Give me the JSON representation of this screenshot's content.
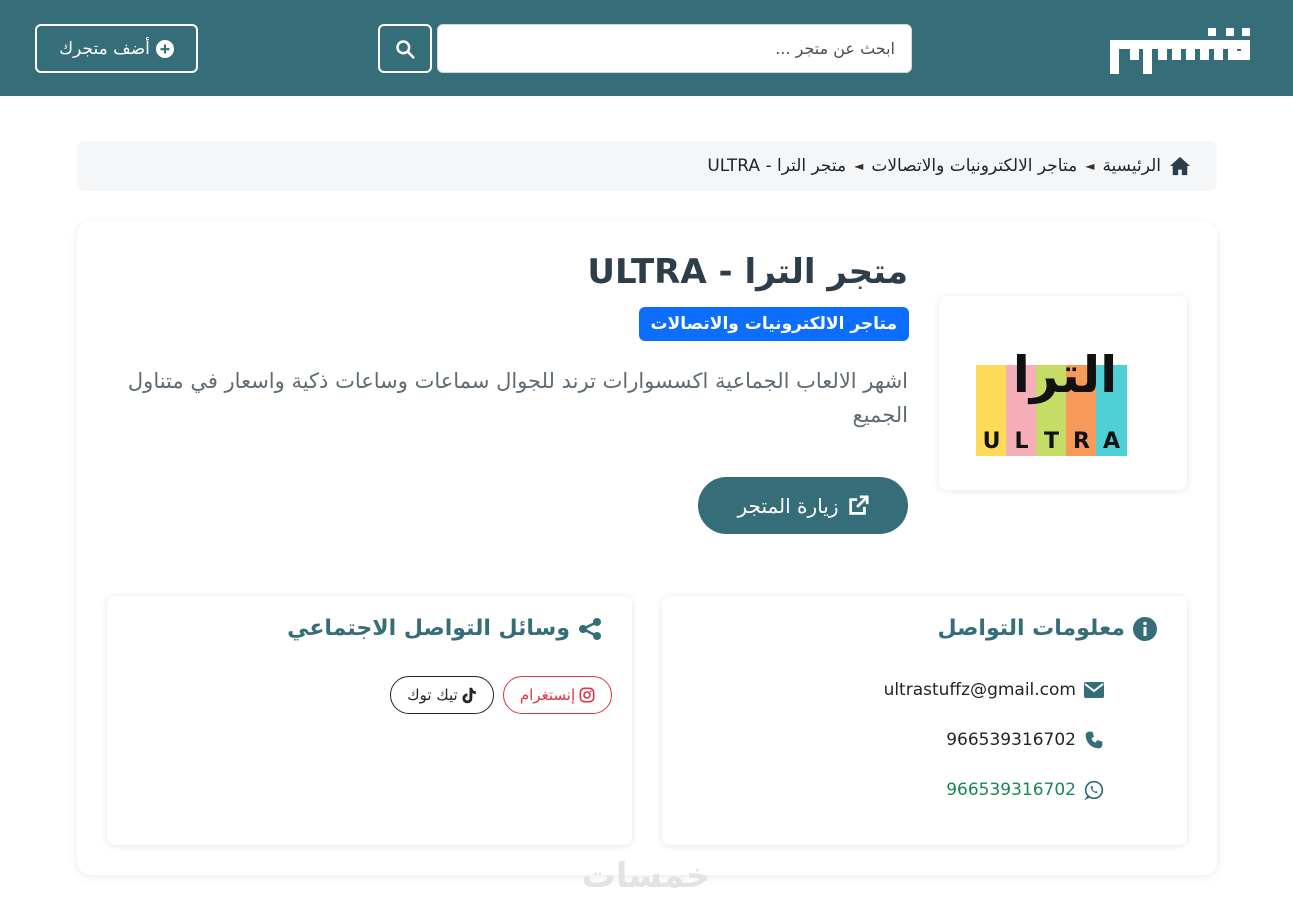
{
  "header": {
    "search_placeholder": "ابحث عن متجر ...",
    "add_store_label": "أضف متجرك"
  },
  "breadcrumb": {
    "home": "الرئيسية",
    "category": "متاجر الالكترونيات والاتصالات",
    "current": "متجر الترا - ULTRA",
    "separator": "◄"
  },
  "store": {
    "title": "متجر الترا - ULTRA",
    "category_badge": "متاجر الالكترونيات والاتصالات",
    "description": "اشهر الالعاب الجماعية اكسسوارات ترند للجوال سماعات وساعات ذكية واسعار في متناول الجميع",
    "visit_label": "زيارة المتجر",
    "logo": {
      "arabic_text": "الترا",
      "latin_letters": [
        "U",
        "L",
        "T",
        "R",
        "A"
      ],
      "bar_colors": [
        "#fddb59",
        "#f6aeb9",
        "#c5dc67",
        "#f89a5a",
        "#4fcfd6"
      ]
    }
  },
  "contact": {
    "heading": "معلومات التواصل",
    "email": "ultrastuffz@gmail.com",
    "phone": "966539316702",
    "whatsapp": "966539316702"
  },
  "social": {
    "heading": "وسائل التواصل الاجتماعي",
    "instagram_label": "إنستغرام",
    "tiktok_label": "تيك توك"
  },
  "watermark": "خمسات",
  "colors": {
    "brand": "#356e78",
    "badge": "#0d6efd",
    "whatsapp": "#198754",
    "instagram": "#dc3545"
  }
}
